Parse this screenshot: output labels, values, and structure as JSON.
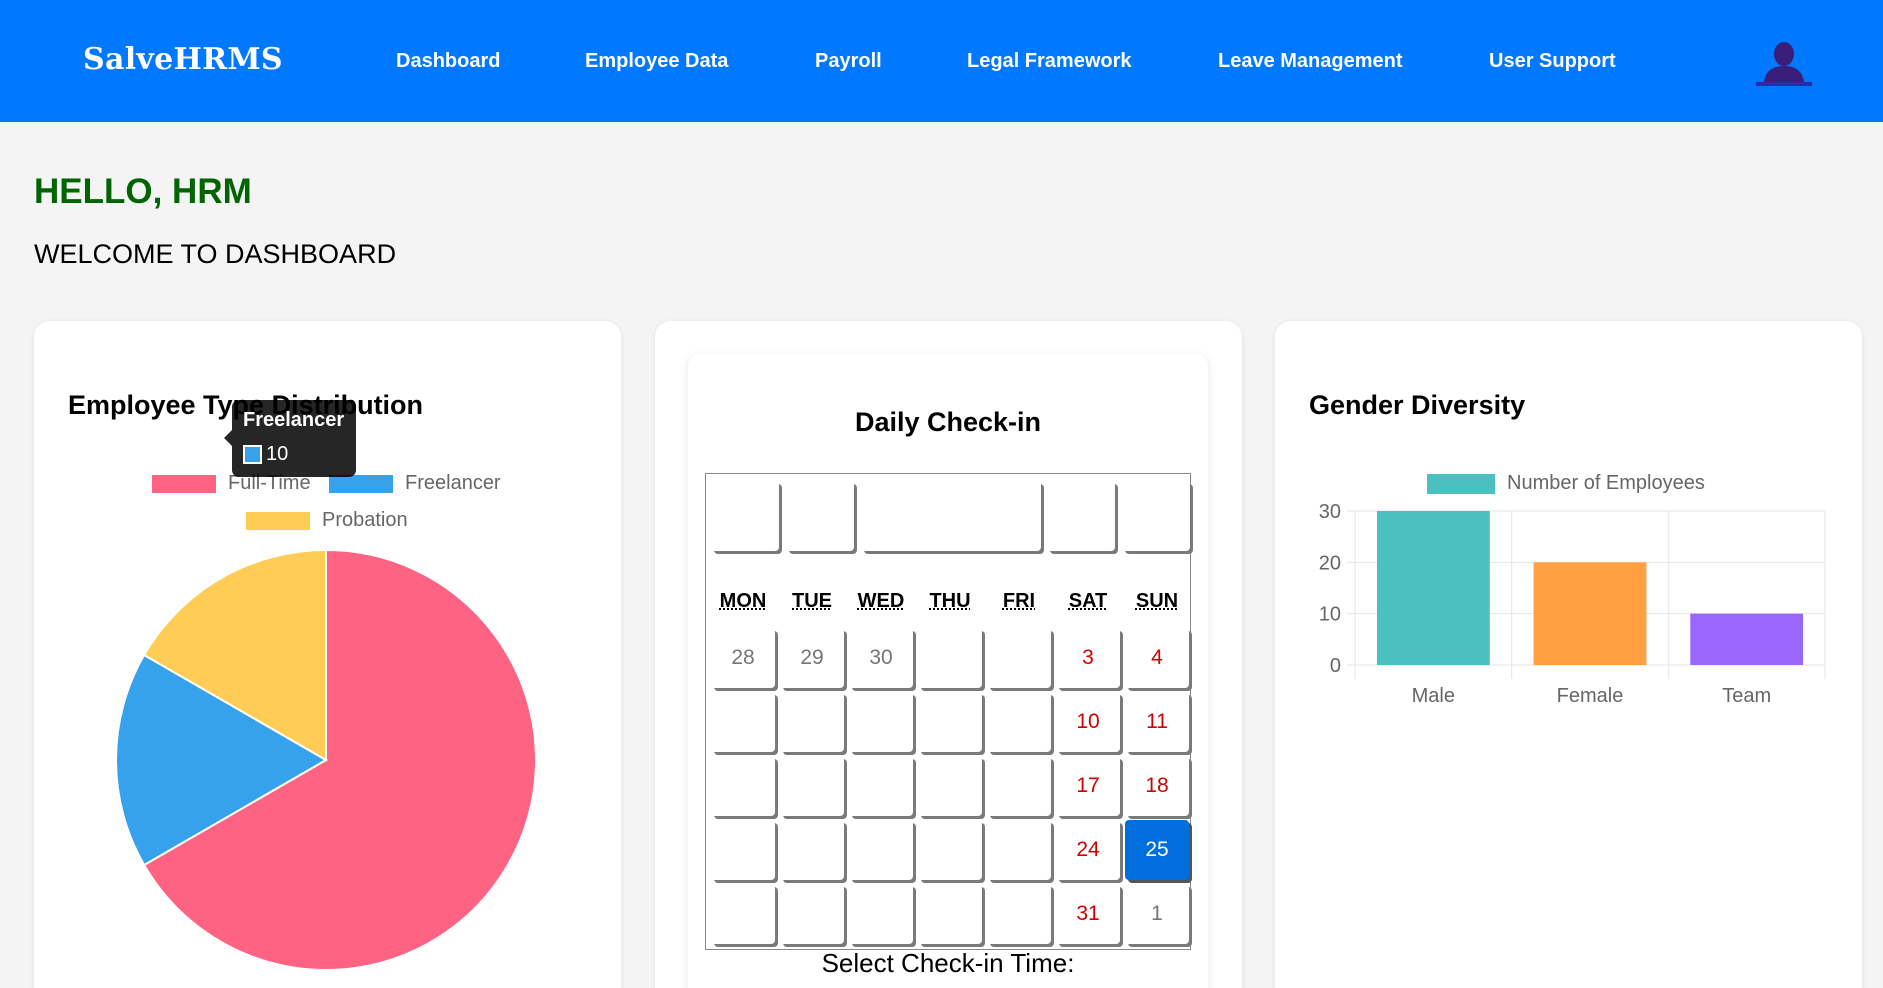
{
  "header": {
    "brand": "SalveHRMS",
    "nav": [
      "Dashboard",
      "Employee Data",
      "Payroll",
      "Legal Framework",
      "Leave Management",
      "User Support"
    ],
    "avatar_icon": "user-avatar-icon"
  },
  "greeting": {
    "hello": "HELLO, HRM",
    "welcome": "WELCOME TO DASHBOARD"
  },
  "employee_type": {
    "title": "Employee Type Distribution",
    "legend": [
      "Full-Time",
      "Freelancer",
      "Probation"
    ],
    "tooltip": {
      "label": "Freelancer",
      "value": "10"
    }
  },
  "calendar": {
    "title": "Daily Check-in",
    "weekdays": [
      "MON",
      "TUE",
      "WED",
      "THU",
      "FRI",
      "SAT",
      "SUN"
    ],
    "weeks": [
      [
        "28",
        "29",
        "30",
        "",
        "",
        "3",
        "4"
      ],
      [
        "",
        "",
        "",
        "",
        "",
        "10",
        "11"
      ],
      [
        "",
        "",
        "",
        "",
        "",
        "17",
        "18"
      ],
      [
        "",
        "",
        "",
        "",
        "",
        "24",
        "25"
      ],
      [
        "",
        "",
        "",
        "",
        "",
        "31",
        "1"
      ]
    ],
    "selected": "25",
    "checkin_label": "Select Check-in Time:"
  },
  "gender": {
    "title": "Gender Diversity",
    "legend": "Number of Employees"
  },
  "colors": {
    "nav_bg": "#0078ff",
    "hello": "#006400",
    "pie_fulltime": "#ff6384",
    "pie_freelancer": "#36a2eb",
    "pie_probation": "#ffcd56",
    "bar_male": "#4bc0c0",
    "bar_female": "#ff9f40",
    "bar_team": "#9966ff",
    "weekend": "#d10000",
    "selected_day": "#006edc"
  },
  "chart_data": [
    {
      "type": "pie",
      "title": "Employee Type Distribution",
      "categories": [
        "Full-Time",
        "Freelancer",
        "Probation"
      ],
      "values": [
        40,
        10,
        10
      ],
      "legend_position": "top"
    },
    {
      "type": "bar",
      "title": "Gender Diversity",
      "categories": [
        "Male",
        "Female",
        "Team"
      ],
      "series": [
        {
          "name": "Number of Employees",
          "values": [
            30,
            20,
            10
          ]
        }
      ],
      "ylim": [
        0,
        30
      ],
      "yticks": [
        "0",
        "10",
        "20",
        "30"
      ],
      "grid": true,
      "legend_position": "top"
    }
  ]
}
